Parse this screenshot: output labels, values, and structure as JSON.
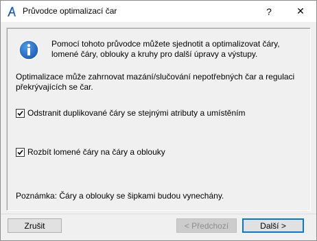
{
  "window": {
    "title": "Průvodce optimalizací čar",
    "help_glyph": "?",
    "close_glyph": "✕"
  },
  "intro": {
    "text": "Pomocí tohoto průvodce můžete sjednotit a optimalizovat čáry, lomené čáry, oblouky a kruhy pro další úpravy a výstupy."
  },
  "description": {
    "text": "Optimalizace může zahrnovat mazání/slučování nepotřebných čar a regulaci překrývajících se čar."
  },
  "options": [
    {
      "label": "Odstranit duplikované čáry se stejnými atributy a umístěním",
      "checked": true
    },
    {
      "label": "Rozbít lomené čáry na čáry a oblouky",
      "checked": true
    }
  ],
  "note": {
    "text": "Poznámka: Čáry a oblouky se šipkami budou vynechány."
  },
  "buttons": {
    "cancel": "Zrušit",
    "back": "< Předchozí",
    "next": "Další >"
  },
  "colors": {
    "info_icon": "#1e5fb4",
    "app_icon": "#1c4fa3",
    "default_button_border": "#0078d7"
  },
  "icons": {
    "app": "archicad-app-icon",
    "info": "info-icon"
  }
}
